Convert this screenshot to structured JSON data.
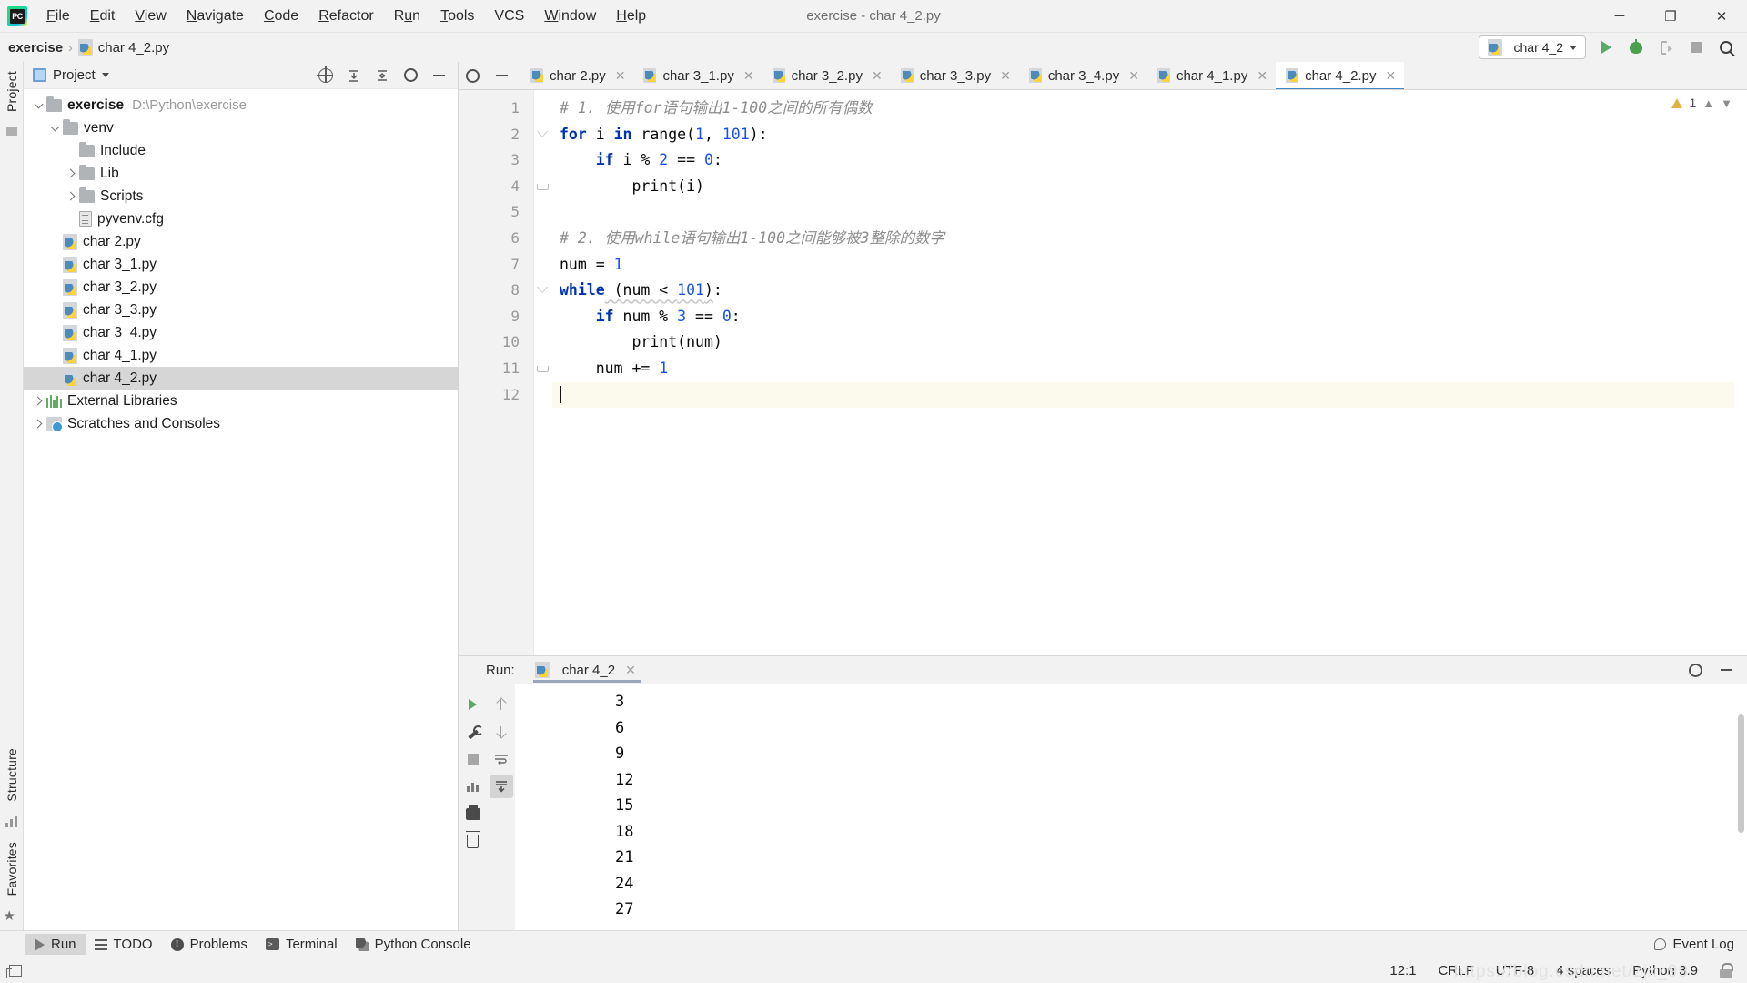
{
  "window": {
    "title": "exercise - char 4_2.py",
    "app_icon": "pycharm-logo-icon",
    "controls": {
      "minimize": "─",
      "maximize": "❐",
      "close": "✕"
    }
  },
  "menubar": {
    "items": [
      {
        "label": "File"
      },
      {
        "label": "Edit"
      },
      {
        "label": "View"
      },
      {
        "label": "Navigate"
      },
      {
        "label": "Code"
      },
      {
        "label": "Refactor"
      },
      {
        "label": "Run"
      },
      {
        "label": "Tools"
      },
      {
        "label": "VCS"
      },
      {
        "label": "Window"
      },
      {
        "label": "Help"
      }
    ]
  },
  "breadcrumb": {
    "project": "exercise",
    "separator": "›",
    "file": "char 4_2.py"
  },
  "toolbar": {
    "run_config_name": "char 4_2",
    "run_button": "run-icon",
    "debug_button": "debug-icon",
    "coverage_button": "run-with-coverage-icon",
    "stop_button": "stop-icon",
    "search_button": "search-everywhere-icon"
  },
  "left_rail": {
    "project_label": "Project",
    "structure_label": "Structure",
    "favorites_label": "Favorites"
  },
  "project_panel": {
    "title": "Project",
    "icons": [
      "locate-icon",
      "expand-all-icon",
      "collapse-all-icon",
      "settings-icon",
      "hide-icon"
    ],
    "tree": [
      {
        "label": "exercise",
        "path": "D:\\Python\\exercise",
        "icon": "folder-icon",
        "indent": 0,
        "arrow": "down",
        "bold": true,
        "selected": false
      },
      {
        "label": "venv",
        "path": "",
        "icon": "folder-icon",
        "indent": 1,
        "arrow": "down",
        "bold": false,
        "selected": false
      },
      {
        "label": "Include",
        "path": "",
        "icon": "folder-icon",
        "indent": 2,
        "arrow": "none",
        "bold": false,
        "selected": false
      },
      {
        "label": "Lib",
        "path": "",
        "icon": "folder-icon",
        "indent": 2,
        "arrow": "right",
        "bold": false,
        "selected": false
      },
      {
        "label": "Scripts",
        "path": "",
        "icon": "folder-icon",
        "indent": 2,
        "arrow": "right",
        "bold": false,
        "selected": false
      },
      {
        "label": "pyvenv.cfg",
        "path": "",
        "icon": "config-file-icon",
        "indent": 2,
        "arrow": "none",
        "bold": false,
        "selected": false
      },
      {
        "label": "char 2.py",
        "path": "",
        "icon": "python-file-icon",
        "indent": 1,
        "arrow": "none",
        "bold": false,
        "selected": false
      },
      {
        "label": "char 3_1.py",
        "path": "",
        "icon": "python-file-icon",
        "indent": 1,
        "arrow": "none",
        "bold": false,
        "selected": false
      },
      {
        "label": "char 3_2.py",
        "path": "",
        "icon": "python-file-icon",
        "indent": 1,
        "arrow": "none",
        "bold": false,
        "selected": false
      },
      {
        "label": "char 3_3.py",
        "path": "",
        "icon": "python-file-icon",
        "indent": 1,
        "arrow": "none",
        "bold": false,
        "selected": false
      },
      {
        "label": "char 3_4.py",
        "path": "",
        "icon": "python-file-icon",
        "indent": 1,
        "arrow": "none",
        "bold": false,
        "selected": false
      },
      {
        "label": "char 4_1.py",
        "path": "",
        "icon": "python-file-icon",
        "indent": 1,
        "arrow": "none",
        "bold": false,
        "selected": false
      },
      {
        "label": "char 4_2.py",
        "path": "",
        "icon": "python-file-icon",
        "indent": 1,
        "arrow": "none",
        "bold": false,
        "selected": true
      },
      {
        "label": "External Libraries",
        "path": "",
        "icon": "libraries-icon",
        "indent": 0,
        "arrow": "right",
        "bold": false,
        "selected": false
      },
      {
        "label": "Scratches and Consoles",
        "path": "",
        "icon": "scratches-icon",
        "indent": 0,
        "arrow": "right",
        "bold": false,
        "selected": false
      }
    ]
  },
  "editor": {
    "tabs": [
      {
        "label": "char 2.py",
        "active": false
      },
      {
        "label": "char 3_1.py",
        "active": false
      },
      {
        "label": "char 3_2.py",
        "active": false
      },
      {
        "label": "char 3_3.py",
        "active": false
      },
      {
        "label": "char 3_4.py",
        "active": false
      },
      {
        "label": "char 4_1.py",
        "active": false
      },
      {
        "label": "char 4_2.py",
        "active": true
      }
    ],
    "inspection": {
      "warning_count": "1"
    },
    "lines": [
      {
        "num": "1",
        "fold": "none",
        "caret": false,
        "tokens": [
          {
            "t": "# 1. 使用for语句输出1-100之间的所有偶数",
            "c": "c"
          }
        ]
      },
      {
        "num": "2",
        "fold": "start",
        "caret": false,
        "tokens": [
          {
            "t": "for",
            "c": "k"
          },
          {
            "t": " i ",
            "c": "op"
          },
          {
            "t": "in",
            "c": "k"
          },
          {
            "t": " range(",
            "c": "op"
          },
          {
            "t": "1",
            "c": "n"
          },
          {
            "t": ", ",
            "c": "op"
          },
          {
            "t": "101",
            "c": "n"
          },
          {
            "t": "):",
            "c": "op"
          }
        ]
      },
      {
        "num": "3",
        "fold": "none",
        "caret": false,
        "tokens": [
          {
            "t": "    ",
            "c": "op"
          },
          {
            "t": "if",
            "c": "k"
          },
          {
            "t": " i % ",
            "c": "op"
          },
          {
            "t": "2",
            "c": "n"
          },
          {
            "t": " == ",
            "c": "op"
          },
          {
            "t": "0",
            "c": "n"
          },
          {
            "t": ":",
            "c": "op"
          }
        ]
      },
      {
        "num": "4",
        "fold": "end",
        "caret": false,
        "tokens": [
          {
            "t": "        print(i)",
            "c": "op"
          }
        ]
      },
      {
        "num": "5",
        "fold": "none",
        "caret": false,
        "tokens": [
          {
            "t": "",
            "c": "op"
          }
        ]
      },
      {
        "num": "6",
        "fold": "none",
        "caret": false,
        "tokens": [
          {
            "t": "# 2. 使用while语句输出1-100之间能够被3整除的数字",
            "c": "c"
          }
        ]
      },
      {
        "num": "7",
        "fold": "none",
        "caret": false,
        "tokens": [
          {
            "t": "num = ",
            "c": "op"
          },
          {
            "t": "1",
            "c": "n"
          }
        ]
      },
      {
        "num": "8",
        "fold": "start",
        "caret": false,
        "tokens": [
          {
            "t": "while",
            "c": "k"
          },
          {
            "t": " (num < ",
            "c": "op wavy"
          },
          {
            "t": "101",
            "c": "n wavy"
          },
          {
            "t": ")",
            "c": "op wavy"
          },
          {
            "t": ":",
            "c": "op"
          }
        ]
      },
      {
        "num": "9",
        "fold": "none",
        "caret": false,
        "tokens": [
          {
            "t": "    ",
            "c": "op"
          },
          {
            "t": "if",
            "c": "k"
          },
          {
            "t": " num % ",
            "c": "op"
          },
          {
            "t": "3",
            "c": "n"
          },
          {
            "t": " == ",
            "c": "op"
          },
          {
            "t": "0",
            "c": "n"
          },
          {
            "t": ":",
            "c": "op"
          }
        ]
      },
      {
        "num": "10",
        "fold": "none",
        "caret": false,
        "tokens": [
          {
            "t": "        print(num)",
            "c": "op"
          }
        ]
      },
      {
        "num": "11",
        "fold": "end",
        "caret": false,
        "tokens": [
          {
            "t": "    num += ",
            "c": "op"
          },
          {
            "t": "1",
            "c": "n"
          }
        ]
      },
      {
        "num": "12",
        "fold": "none",
        "caret": true,
        "tokens": [
          {
            "t": "",
            "c": "op"
          }
        ]
      }
    ]
  },
  "run_panel": {
    "label": "Run:",
    "tab_name": "char 4_2",
    "tab_close": "✕",
    "side_buttons": [
      "rerun-icon",
      "up-icon",
      "down-icon",
      "stop-icon",
      "soft-wrap-icon",
      "scroll-to-end-icon",
      "print-icon",
      "clear-all-icon",
      "settings-icon"
    ],
    "output": [
      "3",
      "6",
      "9",
      "12",
      "15",
      "18",
      "21",
      "24",
      "27"
    ],
    "settings_icon": "gear-icon",
    "hide_icon": "hide-icon"
  },
  "bottom_bar": {
    "items": [
      {
        "label": "Run",
        "icon": "run-icon",
        "active": true
      },
      {
        "label": "TODO",
        "icon": "todo-icon",
        "active": false
      },
      {
        "label": "Problems",
        "icon": "problems-icon",
        "active": false
      },
      {
        "label": "Terminal",
        "icon": "terminal-icon",
        "active": false
      },
      {
        "label": "Python Console",
        "icon": "python-console-icon",
        "active": false
      }
    ],
    "event_log": "Event Log"
  },
  "status_bar": {
    "caret_position": "12:1",
    "line_separator": "CRLF",
    "encoding": "UTF-8",
    "indent": "4 spaces",
    "interpreter": "Python 3.9",
    "lock_icon": "lock-icon",
    "watermark": "https://blog.csdn.net/zjx_99"
  }
}
